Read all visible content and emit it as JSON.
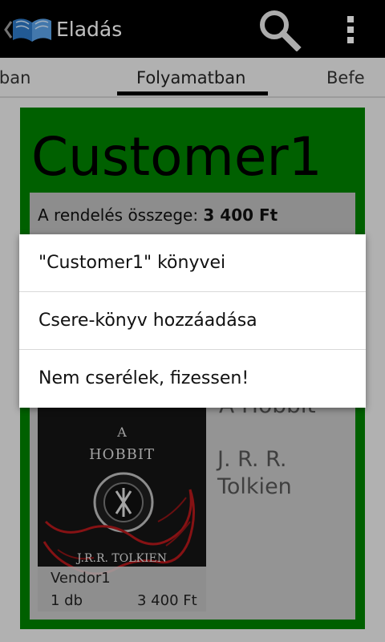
{
  "action_bar": {
    "title": "Eladás",
    "up_icon": "chevron-left-icon",
    "app_icon": "open-book-icon",
    "search_icon": "search-icon",
    "overflow_icon": "overflow-menu-icon",
    "background": "#000000"
  },
  "tabs": {
    "items": [
      {
        "label": "ában"
      },
      {
        "label": "Folyamatban"
      },
      {
        "label": "Befe"
      }
    ],
    "selected": "Folyamatban"
  },
  "card": {
    "background": "#008000",
    "customer": "Customer1",
    "summary_label": "A rendelés összege:",
    "summary_value": "3 400 Ft",
    "book": {
      "title": "A Hobbit",
      "author": "J. R. R. Tolkien",
      "vendor": "Vendor1",
      "quantity": "1 db",
      "price": "3 400 Ft",
      "cover_title_line1": "A",
      "cover_title_line2": "HOBBIT",
      "cover_author": "J.R.R. TOLKIEN"
    }
  },
  "menu": {
    "items": [
      {
        "label": "\"Customer1\" könyvei"
      },
      {
        "label": "Csere-könyv hozzáadása"
      },
      {
        "label": "Nem cserélek, fizessen!"
      }
    ]
  }
}
